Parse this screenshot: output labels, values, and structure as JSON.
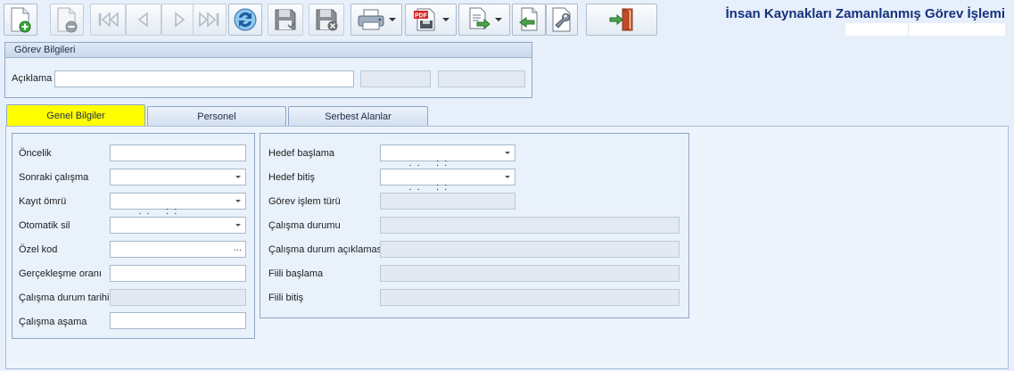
{
  "window": {
    "title": "İnsan Kaynakları Zamanlanmış Görev İşlemi"
  },
  "toolbar": {
    "buttons": [
      {
        "name": "new-record",
        "icon": "new-document-icon",
        "enabled": true
      },
      {
        "name": "delete-record",
        "icon": "delete-document-icon",
        "enabled": false
      },
      {
        "name": "first-record",
        "icon": "first-record-icon",
        "enabled": false
      },
      {
        "name": "previous-record",
        "icon": "previous-record-icon",
        "enabled": false
      },
      {
        "name": "next-record",
        "icon": "next-record-icon",
        "enabled": false
      },
      {
        "name": "last-record",
        "icon": "last-record-icon",
        "enabled": false
      },
      {
        "name": "refresh",
        "icon": "refresh-icon",
        "enabled": true
      },
      {
        "name": "save",
        "icon": "save-icon",
        "enabled": false
      },
      {
        "name": "cancel-save",
        "icon": "cancel-save-icon",
        "enabled": false
      },
      {
        "name": "print",
        "icon": "printer-icon",
        "enabled": true
      },
      {
        "name": "pdf-export",
        "icon": "pdf-icon",
        "label": "PDF",
        "enabled": true
      },
      {
        "name": "documents",
        "icon": "document-list-icon",
        "enabled": true
      },
      {
        "name": "import",
        "icon": "import-document-icon",
        "enabled": true
      },
      {
        "name": "tools",
        "icon": "wrench-icon",
        "enabled": true
      },
      {
        "name": "exit",
        "icon": "exit-door-icon",
        "enabled": true
      }
    ]
  },
  "task_info": {
    "group_title": "Görev Bilgileri",
    "description_label": "Açıklama",
    "description_value": "",
    "extra_field_1": "",
    "extra_field_2": ""
  },
  "tabs": [
    {
      "label": "Genel Bilgiler",
      "active": true
    },
    {
      "label": "Personel",
      "active": false
    },
    {
      "label": "Serbest Alanlar",
      "active": false
    }
  ],
  "general": {
    "left": [
      {
        "label": "Öncelik",
        "value": "",
        "type": "text"
      },
      {
        "label": "Sonraki çalışma",
        "value": "",
        "type": "dropdown"
      },
      {
        "label": "Kayıt ömrü",
        "value": " .  .      :  :",
        "type": "dropdown"
      },
      {
        "label": "Otomatik sil",
        "value": "",
        "type": "dropdown"
      },
      {
        "label": "Özel kod",
        "value": "",
        "type": "ellipsis",
        "button": "..."
      },
      {
        "label": "Gerçekleşme oranı",
        "value": "",
        "type": "text"
      },
      {
        "label": "Çalışma durum tarihi",
        "value": "",
        "type": "readonly"
      },
      {
        "label": "Çalışma aşama",
        "value": "",
        "type": "text"
      }
    ],
    "right": [
      {
        "label": "Hedef başlama",
        "value": " .  .      :  :",
        "type": "dropdown"
      },
      {
        "label": "Hedef bitiş",
        "value": " .  .      :  :",
        "type": "dropdown"
      },
      {
        "label": "Görev işlem türü",
        "value": "",
        "type": "readonly"
      },
      {
        "label": "Çalışma durumu",
        "value": "",
        "type": "readonly"
      },
      {
        "label": "Çalışma durum açıklaması",
        "value": "",
        "type": "readonly"
      },
      {
        "label": "Fiili başlama",
        "value": "",
        "type": "readonly"
      },
      {
        "label": "Fiili bitiş",
        "value": "",
        "type": "readonly"
      }
    ]
  }
}
